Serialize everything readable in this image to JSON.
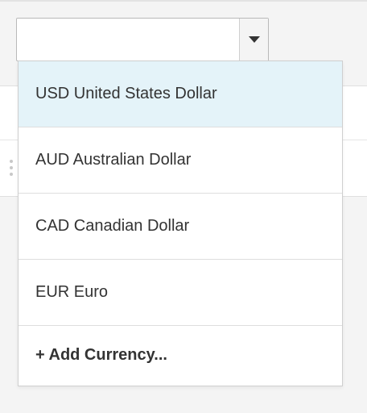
{
  "select": {
    "value": "",
    "arrow_icon": "caret-down-icon"
  },
  "dropdown": {
    "options": [
      {
        "label": "USD United States Dollar",
        "selected": true
      },
      {
        "label": "AUD Australian Dollar",
        "selected": false
      },
      {
        "label": "CAD Canadian Dollar",
        "selected": false
      },
      {
        "label": "EUR Euro",
        "selected": false
      }
    ],
    "add_label": "+ Add Currency...",
    "highlight_color": "#e4f3f9"
  },
  "background": {
    "drag_handle_icon": "drag-handle-icon"
  }
}
